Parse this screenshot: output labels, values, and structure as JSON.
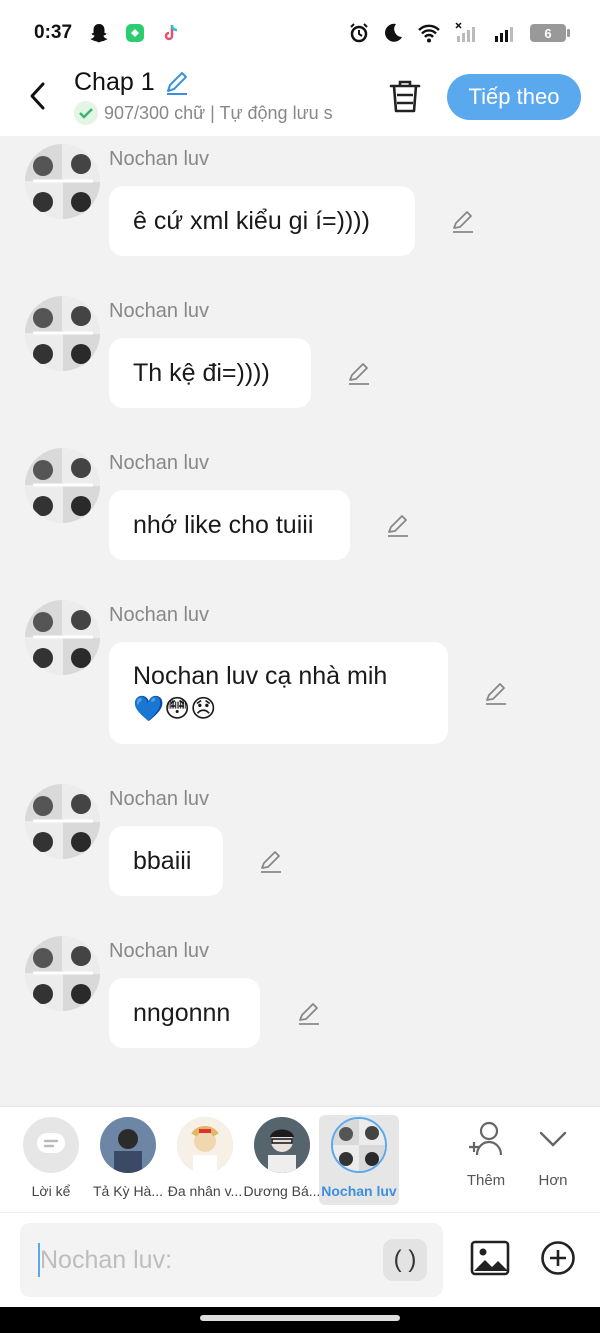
{
  "status_bar": {
    "time": "0:37",
    "battery": "6"
  },
  "header": {
    "title": "Chap 1",
    "subtitle": "907/300 chữ | Tự động lưu s",
    "next_label": "Tiếp theo"
  },
  "messages": [
    {
      "sender": "Nochan luv",
      "text": "ê cứ xml kiểu gi í=))))"
    },
    {
      "sender": "Nochan luv",
      "text": "Th kệ đi=))))"
    },
    {
      "sender": "Nochan luv",
      "text": "nhớ like cho tuiii"
    },
    {
      "sender": "Nochan luv",
      "text": "Nochan luv cạ nhà mih",
      "text2": "💙😳😞"
    },
    {
      "sender": "Nochan luv",
      "text": "bbaiii"
    },
    {
      "sender": "Nochan luv",
      "text": "nngonnn"
    }
  ],
  "characters": [
    {
      "label": "Lời kể"
    },
    {
      "label": "Tả Kỳ Hà..."
    },
    {
      "label": "Đa nhân v..."
    },
    {
      "label": "Dương Bá..."
    },
    {
      "label": "Nochan luv"
    }
  ],
  "tools": {
    "add_label": "Thêm",
    "more_label": "Hơn"
  },
  "composer": {
    "placeholder": "Nochan luv:",
    "paren_label": "( )"
  },
  "colors": {
    "accent": "#5aa9ee",
    "background": "#f2f2f2",
    "bubble": "#ffffff"
  }
}
